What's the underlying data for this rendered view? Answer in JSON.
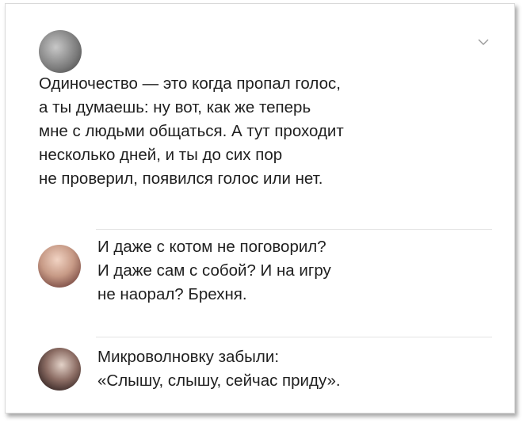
{
  "post": {
    "author_name": "",
    "author_handle": "",
    "lines": [
      "Одиночество — это когда пропал голос,",
      "а ты думаешь: ну вот, как же теперь",
      "мне с людьми общаться. А тут проходит",
      "несколько дней, и ты до сих пор",
      "не проверил, появился голос или нет."
    ]
  },
  "comments": [
    {
      "lines": [
        "И даже с котом не поговорил?",
        "И даже сам с собой? И на игру",
        "не наорал? Брехня."
      ]
    },
    {
      "lines": [
        "Микроволновку забыли:",
        "«Слышу, слышу, сейчас приду»."
      ]
    }
  ],
  "icons": {
    "menu": "chevron-down-icon"
  }
}
